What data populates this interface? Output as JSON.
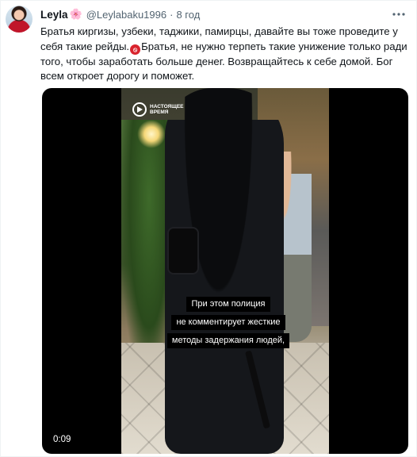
{
  "tweet": {
    "author": {
      "display_name": "Leyla",
      "name_emoji": "🌸",
      "handle": "@Leylabaku1996",
      "separator": "·",
      "time": "8 год"
    },
    "more_icon": "more-horizontal-icon",
    "text_part1": "Братья киргизы, узбеки, таджики, памирцы, давайте вы тоже проведите у себя такие рейды.",
    "inline_emoji": "🚫",
    "text_part2": "Братья, не нужно терпеть такие унижение только ради того, чтобы заработать больше денег. Возвращайтесь к себе домой. Бог всем откроет дорогу и поможет.",
    "media": {
      "type": "video",
      "logo_text": "НАСТОЯЩЕЕ ВРЕМЯ",
      "captions": [
        "При этом полиция",
        "не комментирует жесткие",
        "методы задержания людей,"
      ],
      "duration": "0:09"
    }
  }
}
